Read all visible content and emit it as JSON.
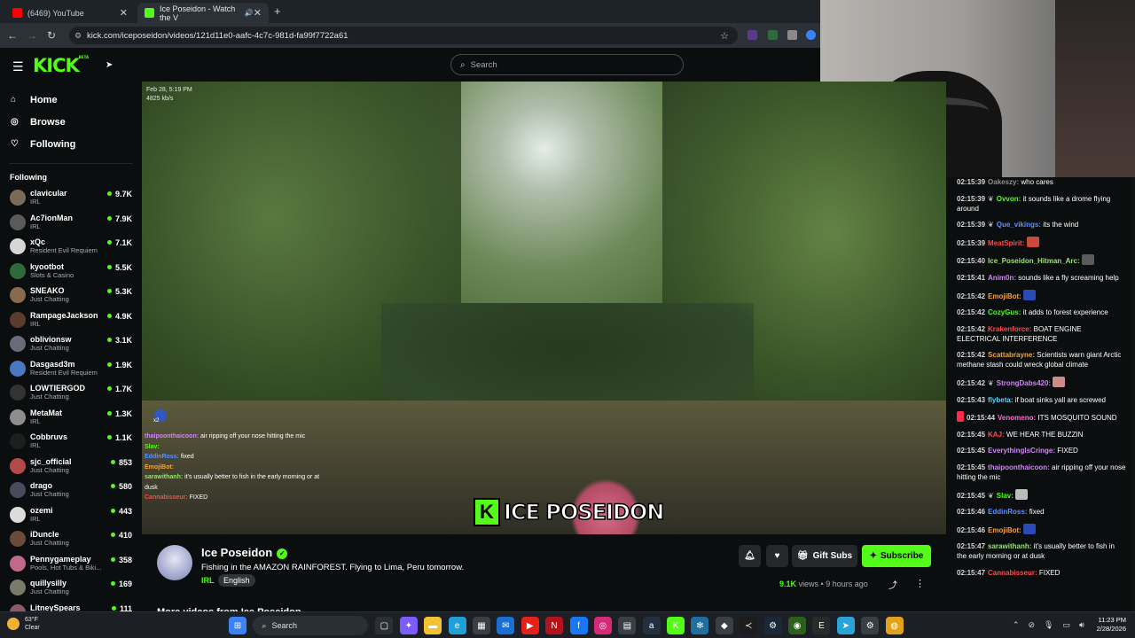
{
  "browser": {
    "tabs": [
      {
        "label": "(6469) YouTube",
        "color": "#ff0000"
      },
      {
        "label": "Ice Poseidon - Watch the V",
        "color": "#53fc18"
      }
    ],
    "new_tab": "+",
    "url": "kick.com/iceposeidon/videos/121d11e0-aafc-4c7c-981d-fa99f7722a61"
  },
  "header": {
    "logo": "KICK",
    "logo_sup": "BETA",
    "search_placeholder": "Search"
  },
  "nav": [
    {
      "label": "Home",
      "icon": "home-icon",
      "glyph": "⌂"
    },
    {
      "label": "Browse",
      "icon": "compass-icon",
      "glyph": "◎"
    },
    {
      "label": "Following",
      "icon": "heart-icon",
      "glyph": "♡"
    }
  ],
  "following_label": "Following",
  "following": [
    {
      "name": "clavicular",
      "category": "IRL",
      "viewers": "9.7K",
      "color": "#7a6a5a"
    },
    {
      "name": "Ac7ionMan",
      "category": "IRL",
      "viewers": "7.9K",
      "color": "#5a5a5a"
    },
    {
      "name": "xQc",
      "category": "Resident Evil Requiem",
      "viewers": "7.1K",
      "color": "#d6d6d6"
    },
    {
      "name": "kyootbot",
      "category": "Slots & Casino",
      "viewers": "5.5K",
      "color": "#2f6b3a"
    },
    {
      "name": "SNEAKO",
      "category": "Just Chatting",
      "viewers": "5.3K",
      "color": "#8a6a4e"
    },
    {
      "name": "RampageJackson",
      "category": "IRL",
      "viewers": "4.9K",
      "color": "#5b3b2b"
    },
    {
      "name": "oblivionsw",
      "category": "Just Chatting",
      "viewers": "3.1K",
      "color": "#6a6a7a"
    },
    {
      "name": "Dasgasd3m",
      "category": "Resident Evil Requiem",
      "viewers": "1.9K",
      "color": "#4a78c0"
    },
    {
      "name": "LOWTIERGOD",
      "category": "Just Chatting",
      "viewers": "1.7K",
      "color": "#333333"
    },
    {
      "name": "MetaMat",
      "category": "IRL",
      "viewers": "1.3K",
      "color": "#8e8e8e"
    },
    {
      "name": "Cobbruvs",
      "category": "IRL",
      "viewers": "1.1K",
      "color": "#1e1e1e"
    },
    {
      "name": "sjc_official",
      "category": "Just Chatting",
      "viewers": "853",
      "color": "#b34a4a"
    },
    {
      "name": "drago",
      "category": "Just Chatting",
      "viewers": "580",
      "color": "#4a4a5a"
    },
    {
      "name": "ozemi",
      "category": "IRL",
      "viewers": "443",
      "color": "#dcdcdc"
    },
    {
      "name": "iDuncle",
      "category": "Just Chatting",
      "viewers": "410",
      "color": "#6a4a3a"
    },
    {
      "name": "Pennygameplay",
      "category": "Pools, Hot Tubs & Biki...",
      "viewers": "358",
      "color": "#c06a8a"
    },
    {
      "name": "quillysilly",
      "category": "Just Chatting",
      "viewers": "169",
      "color": "#7a7a6a"
    },
    {
      "name": "LitneySpears",
      "category": "",
      "viewers": "111",
      "color": "#8a5a6a"
    }
  ],
  "player": {
    "timestamp": "Feb 28, 5:19 PM",
    "bitrate": "4825 kb/s",
    "emote_count": "x2",
    "watermark_letter": "K",
    "watermark": "ICE POSEIDON",
    "overlay_chat": [
      {
        "user": "thaipoonthaicoon:",
        "text": " air ripping off your nose hitting the mic",
        "color": "#d086f2"
      },
      {
        "user": "Slav:",
        "text": "",
        "color": "#53fc18"
      },
      {
        "user": "EddinRoss:",
        "text": " fixed",
        "color": "#5c8fff"
      },
      {
        "user": "EmojiBot:",
        "text": "",
        "color": "#f2a33a"
      },
      {
        "user": "sarawithanh:",
        "text": " it's usually better to fish in the early morning or at dusk",
        "color": "#9be36a"
      },
      {
        "user": "Cannabisseur:",
        "text": " FIXED",
        "color": "#ff4a4a"
      }
    ]
  },
  "channel": {
    "name": "Ice Poseidon",
    "verified_glyph": "✓",
    "title": "Fishing in the AMAZON RAINFOREST. Flying to Lima, Peru tomorrow.",
    "category": "IRL",
    "language": "English",
    "gift_label": "Gift Subs",
    "subscribe_label": "Subscribe",
    "views_count": "9.1K",
    "views_word": "views",
    "age": "9 hours ago",
    "more_videos": "More videos from Ice Poseidon"
  },
  "chat": [
    {
      "time": "02:15:39",
      "user": "Oakeszy:",
      "text": " who cares",
      "color": "#8f8f8f",
      "badge": ""
    },
    {
      "time": "02:15:39",
      "user": "Ovvon:",
      "text": " it sounds like a drome flying around",
      "color": "#53fc18",
      "badge": "wreath"
    },
    {
      "time": "02:15:39",
      "user": "Que_vikings:",
      "text": " its the wind",
      "color": "#5c8fff",
      "badge": "wreath"
    },
    {
      "time": "02:15:39",
      "user": "MeatSpirit:",
      "text": "",
      "color": "#ff4a4a",
      "badge": "",
      "emote": "#c84a3a"
    },
    {
      "time": "02:15:40",
      "user": "Ice_Poseidon_Hitman_Arc:",
      "text": "",
      "color": "#9be36a",
      "badge": "",
      "emote": "#5a5a5a"
    },
    {
      "time": "02:15:41",
      "user": "Anim0n:",
      "text": " sounds like a fly screaming help",
      "color": "#d086f2",
      "badge": ""
    },
    {
      "time": "02:15:42",
      "user": "EmojiBot:",
      "text": "",
      "color": "#f2a33a",
      "badge": "",
      "emote": "#2a4ab8"
    },
    {
      "time": "02:15:42",
      "user": "CozyGus:",
      "text": " it adds to forest experience",
      "color": "#53fc18",
      "badge": ""
    },
    {
      "time": "02:15:42",
      "user": "Krakenforce:",
      "text": " BOAT ENGINE ELECTRICAL INTERFERENCE",
      "color": "#ff4a4a",
      "badge": ""
    },
    {
      "time": "02:15:42",
      "user": "Scattabrayne:",
      "text": " Scientists warn giant Arctic methane stash could wreck global climate",
      "color": "#f2a33a",
      "badge": ""
    },
    {
      "time": "02:15:42",
      "user": "StrongDabs420:",
      "text": "",
      "color": "#d086f2",
      "badge": "wreath",
      "emote": "#d08a8a"
    },
    {
      "time": "02:15:43",
      "user": "flybeta:",
      "text": " if boat sinks yall are screwed",
      "color": "#5cd0ff",
      "badge": ""
    },
    {
      "time": "02:15:44",
      "user": "Venomeno:",
      "text": " ITS MOSQUITO SOUND",
      "color": "#ff6ad0",
      "badge": "",
      "pre_emote": "#ff2a4a"
    },
    {
      "time": "02:15:45",
      "user": "KAJ:",
      "text": " WE HEAR THE BUZZIN",
      "color": "#ff4a4a",
      "badge": ""
    },
    {
      "time": "02:15:45",
      "user": "EverythingIsCringe:",
      "text": " FIXED",
      "color": "#d086f2",
      "badge": ""
    },
    {
      "time": "02:15:45",
      "user": "thaipoonthaicoon:",
      "text": " air ripping off your nose hitting the mic",
      "color": "#d086f2",
      "badge": ""
    },
    {
      "time": "02:15:45",
      "user": "Slav:",
      "text": "",
      "color": "#53fc18",
      "badge": "wreath",
      "emote": "#bcbcbc"
    },
    {
      "time": "02:15:46",
      "user": "EddinRoss:",
      "text": " fixed",
      "color": "#5c8fff",
      "badge": ""
    },
    {
      "time": "02:15:46",
      "user": "EmojiBot:",
      "text": "",
      "color": "#f2a33a",
      "badge": "",
      "emote": "#2a4ab8"
    },
    {
      "time": "02:15:47",
      "user": "sarawithanh:",
      "text": " it's usually better to fish in the early morning or at dusk",
      "color": "#9be36a",
      "badge": ""
    },
    {
      "time": "02:15:47",
      "user": "Cannabisseur:",
      "text": " FIXED",
      "color": "#ff4a4a",
      "badge": ""
    }
  ],
  "taskbar": {
    "temp": "63°F",
    "weather": "Clear",
    "search": "Search",
    "time": "11:23 PM",
    "date": "2/28/2026",
    "apps": [
      {
        "name": "windows-start-icon",
        "color": "#3b82f6",
        "glyph": "⊞"
      },
      {
        "name": "task-view-icon",
        "color": "#2a2f35",
        "glyph": "▢"
      },
      {
        "name": "copilot-icon",
        "color": "#7c5cff",
        "glyph": "✦"
      },
      {
        "name": "file-explorer-icon",
        "color": "#f2c233",
        "glyph": "▬"
      },
      {
        "name": "edge-icon",
        "color": "#1fa0d6",
        "glyph": "e"
      },
      {
        "name": "calendar-icon",
        "color": "#3a3f46",
        "glyph": "▦"
      },
      {
        "name": "outlook-icon",
        "color": "#1a6fd0",
        "glyph": "✉"
      },
      {
        "name": "youtube-icon",
        "color": "#e62117",
        "glyph": "▶"
      },
      {
        "name": "netflix-icon",
        "color": "#b3141c",
        "glyph": "N"
      },
      {
        "name": "facebook-icon",
        "color": "#1877f2",
        "glyph": "f"
      },
      {
        "name": "instagram-icon",
        "color": "#d62976",
        "glyph": "◎"
      },
      {
        "name": "film-icon",
        "color": "#3a3f46",
        "glyph": "▤"
      },
      {
        "name": "amazon-icon",
        "color": "#232f3e",
        "glyph": "a"
      },
      {
        "name": "kick-app-icon",
        "color": "#53fc18",
        "glyph": "K"
      },
      {
        "name": "snowflake-icon",
        "color": "#1f6fa0",
        "glyph": "✻"
      },
      {
        "name": "roblox-icon",
        "color": "#3a3f46",
        "glyph": "◆"
      },
      {
        "name": "capcut-icon",
        "color": "#1c1c1c",
        "glyph": "≺"
      },
      {
        "name": "steam-icon",
        "color": "#1b2838",
        "glyph": "⚙"
      },
      {
        "name": "nvidia-icon",
        "color": "#2b5f1a",
        "glyph": "◉"
      },
      {
        "name": "epic-icon",
        "color": "#2a2a2a",
        "glyph": "E"
      },
      {
        "name": "telegram-icon",
        "color": "#2aa3d8",
        "glyph": "➤"
      },
      {
        "name": "settings-icon",
        "color": "#3a3f46",
        "glyph": "⚙"
      },
      {
        "name": "chrome-icon",
        "color": "#e0a21c",
        "glyph": "◍"
      }
    ]
  }
}
